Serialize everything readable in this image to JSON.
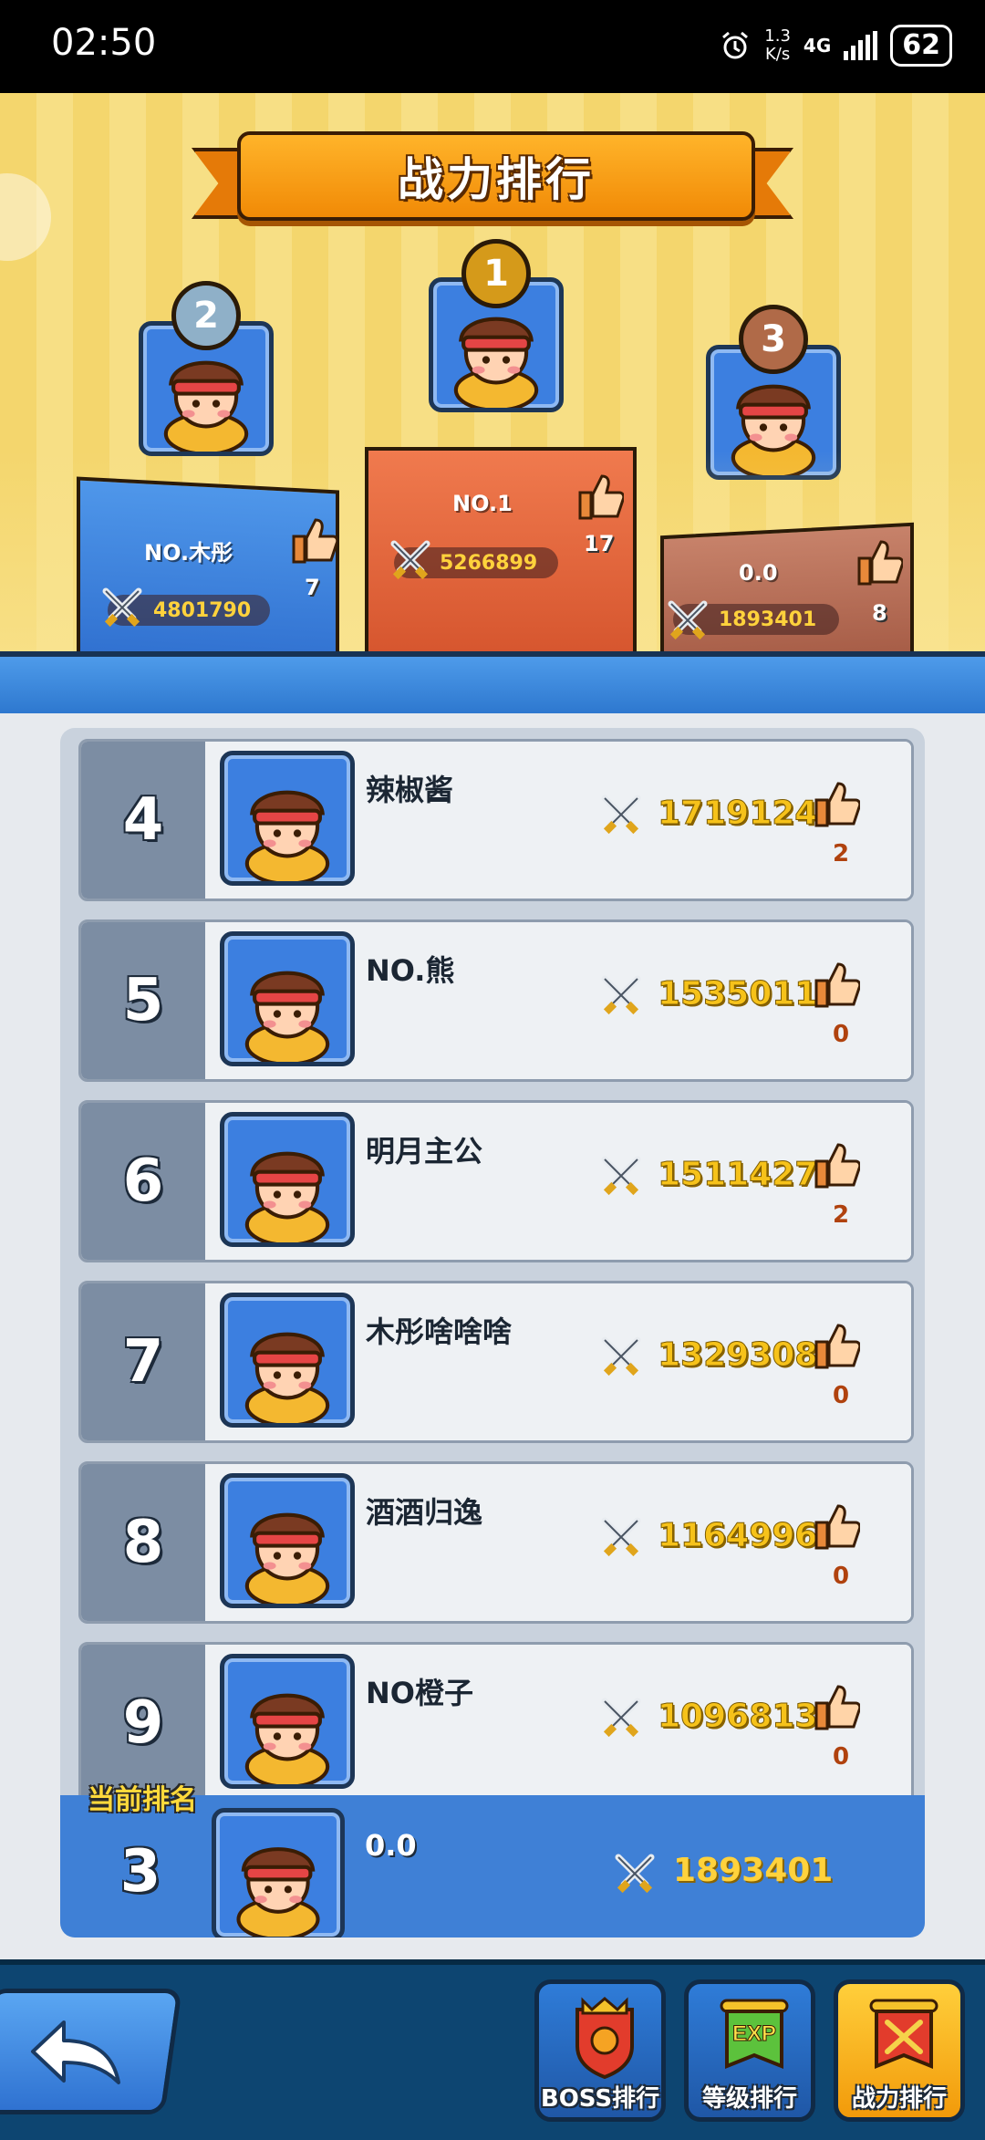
{
  "status": {
    "time": "02:50",
    "net_speed_top": "1.3",
    "net_speed_bottom": "K/s",
    "network": "4G",
    "battery": "62"
  },
  "header": {
    "title": "战力排行"
  },
  "podium": [
    {
      "rank": "1",
      "name": "NO.1",
      "power": "5266899",
      "likes": "17"
    },
    {
      "rank": "2",
      "name": "NO.木彤",
      "power": "4801790",
      "likes": "7"
    },
    {
      "rank": "3",
      "name": "0.0",
      "power": "1893401",
      "likes": "8"
    }
  ],
  "list": [
    {
      "rank": "4",
      "name": "辣椒酱",
      "power": "1719124",
      "likes": "2"
    },
    {
      "rank": "5",
      "name": "NO.熊",
      "power": "1535011",
      "likes": "0"
    },
    {
      "rank": "6",
      "name": "明月主公",
      "power": "1511427",
      "likes": "2"
    },
    {
      "rank": "7",
      "name": "木彤啥啥啥",
      "power": "1329308",
      "likes": "0"
    },
    {
      "rank": "8",
      "name": "酒酒归逸",
      "power": "1164996",
      "likes": "0"
    },
    {
      "rank": "9",
      "name": "NO橙子",
      "power": "1096813",
      "likes": "0"
    }
  ],
  "current": {
    "label": "当前排名",
    "rank": "3",
    "name": "0.0",
    "power": "1893401"
  },
  "nav": {
    "boss": "BOSS排行",
    "level": "等级排行",
    "power": "战力排行",
    "exp_tag": "EXP"
  },
  "colors": {
    "gold_text": "#ffd23c",
    "accent_blue": "#3f80d6",
    "banner_orange": "#f18a06"
  }
}
